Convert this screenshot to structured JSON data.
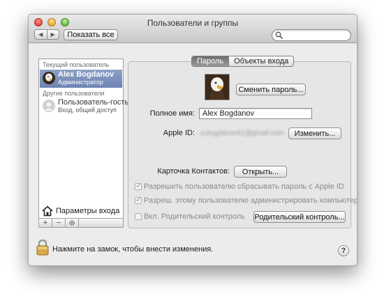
{
  "window": {
    "title": "Пользователи и группы"
  },
  "toolbar": {
    "back_glyph": "◀",
    "forward_glyph": "▶",
    "show_all_label": "Показать все",
    "search_placeholder": "",
    "search_icon": "magnifier-icon"
  },
  "sidebar": {
    "current_header": "Текущий пользователь",
    "current_user": {
      "name": "Alex Bogdanov",
      "role": "Администратор",
      "avatar_icon": "eagle-avatar"
    },
    "others_header": "Другие пользователи",
    "guest_user": {
      "name": "Пользователь-гость",
      "role": "Вход, общий доступ",
      "avatar_icon": "generic-user-icon"
    },
    "login_options_label": "Параметры входа",
    "login_options_icon": "house-icon",
    "add_label": "+",
    "remove_label": "−",
    "action_icon": "gear-icon"
  },
  "tabs": [
    {
      "label": "Пароль",
      "active": true
    },
    {
      "label": "Объекты входа",
      "active": false
    }
  ],
  "password_tab": {
    "change_password_label": "Сменить пароль...",
    "full_name_label": "Полное имя:",
    "full_name_value": "Alex Bogdanov",
    "apple_id_label": "Apple ID:",
    "apple_id_value": "a.bogdanov91@gmail.com",
    "change_apple_id_label": "Изменить...",
    "contact_card_label": "Карточка Контактов:",
    "open_label": "Открыть...",
    "allow_reset_label": "Разрешить пользователю сбрасывать пароль с Apple ID",
    "allow_reset_checked": true,
    "allow_admin_label": "Разреш. этому пользователю администрировать компьютер",
    "allow_admin_checked": true,
    "parental_label": "Вкл. Родительский контроль",
    "parental_checked": false,
    "parental_button_label": "Родительский контроль..."
  },
  "footer": {
    "lock_text": "Нажмите на замок, чтобы внести изменения.",
    "lock_icon": "lock-icon",
    "help_label": "?"
  },
  "colors": {
    "selection": "#7b8fbd",
    "window_bg": "#ececec"
  }
}
